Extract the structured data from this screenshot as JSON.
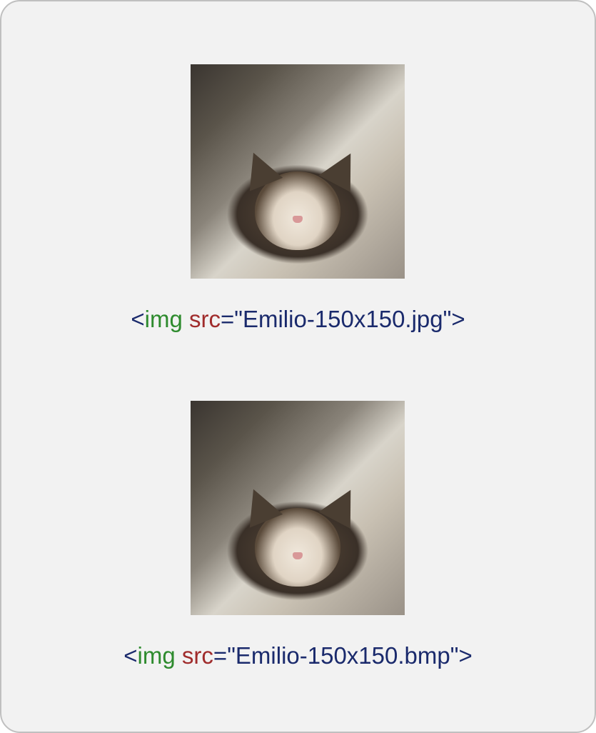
{
  "examples": [
    {
      "image_alt": "Cat photo (JPG)",
      "code": {
        "open": "<",
        "tag": "img",
        "space": " ",
        "attr": "src",
        "eq": "=",
        "val": "\"Emilio-150x150.jpg\"",
        "close": ">"
      }
    },
    {
      "image_alt": "Cat photo (BMP)",
      "code": {
        "open": "<",
        "tag": "img",
        "space": " ",
        "attr": "src",
        "eq": "=",
        "val": "\"Emilio-150x150.bmp\"",
        "close": ">"
      }
    }
  ]
}
